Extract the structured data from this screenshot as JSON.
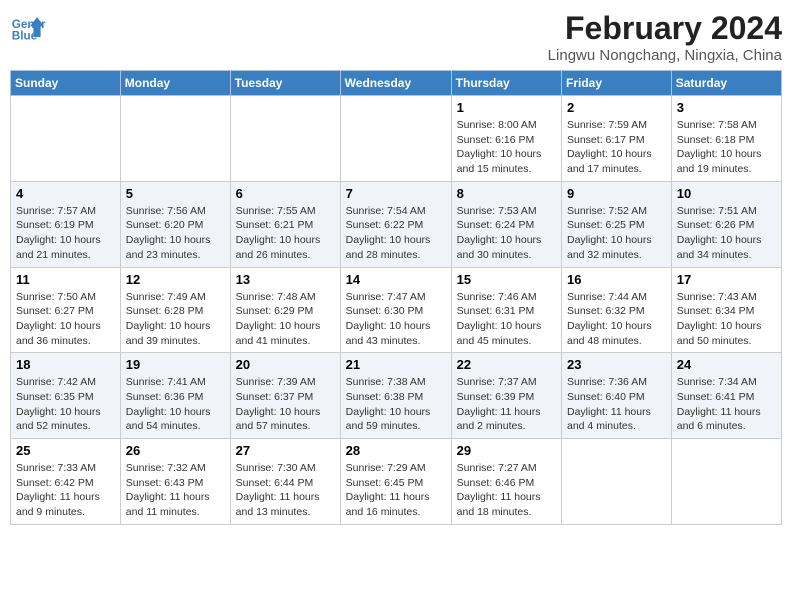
{
  "header": {
    "logo_line1": "General",
    "logo_line2": "Blue",
    "main_title": "February 2024",
    "subtitle": "Lingwu Nongchang, Ningxia, China"
  },
  "weekdays": [
    "Sunday",
    "Monday",
    "Tuesday",
    "Wednesday",
    "Thursday",
    "Friday",
    "Saturday"
  ],
  "weeks": [
    [
      {
        "day": "",
        "info": ""
      },
      {
        "day": "",
        "info": ""
      },
      {
        "day": "",
        "info": ""
      },
      {
        "day": "",
        "info": ""
      },
      {
        "day": "1",
        "info": "Sunrise: 8:00 AM\nSunset: 6:16 PM\nDaylight: 10 hours\nand 15 minutes."
      },
      {
        "day": "2",
        "info": "Sunrise: 7:59 AM\nSunset: 6:17 PM\nDaylight: 10 hours\nand 17 minutes."
      },
      {
        "day": "3",
        "info": "Sunrise: 7:58 AM\nSunset: 6:18 PM\nDaylight: 10 hours\nand 19 minutes."
      }
    ],
    [
      {
        "day": "4",
        "info": "Sunrise: 7:57 AM\nSunset: 6:19 PM\nDaylight: 10 hours\nand 21 minutes."
      },
      {
        "day": "5",
        "info": "Sunrise: 7:56 AM\nSunset: 6:20 PM\nDaylight: 10 hours\nand 23 minutes."
      },
      {
        "day": "6",
        "info": "Sunrise: 7:55 AM\nSunset: 6:21 PM\nDaylight: 10 hours\nand 26 minutes."
      },
      {
        "day": "7",
        "info": "Sunrise: 7:54 AM\nSunset: 6:22 PM\nDaylight: 10 hours\nand 28 minutes."
      },
      {
        "day": "8",
        "info": "Sunrise: 7:53 AM\nSunset: 6:24 PM\nDaylight: 10 hours\nand 30 minutes."
      },
      {
        "day": "9",
        "info": "Sunrise: 7:52 AM\nSunset: 6:25 PM\nDaylight: 10 hours\nand 32 minutes."
      },
      {
        "day": "10",
        "info": "Sunrise: 7:51 AM\nSunset: 6:26 PM\nDaylight: 10 hours\nand 34 minutes."
      }
    ],
    [
      {
        "day": "11",
        "info": "Sunrise: 7:50 AM\nSunset: 6:27 PM\nDaylight: 10 hours\nand 36 minutes."
      },
      {
        "day": "12",
        "info": "Sunrise: 7:49 AM\nSunset: 6:28 PM\nDaylight: 10 hours\nand 39 minutes."
      },
      {
        "day": "13",
        "info": "Sunrise: 7:48 AM\nSunset: 6:29 PM\nDaylight: 10 hours\nand 41 minutes."
      },
      {
        "day": "14",
        "info": "Sunrise: 7:47 AM\nSunset: 6:30 PM\nDaylight: 10 hours\nand 43 minutes."
      },
      {
        "day": "15",
        "info": "Sunrise: 7:46 AM\nSunset: 6:31 PM\nDaylight: 10 hours\nand 45 minutes."
      },
      {
        "day": "16",
        "info": "Sunrise: 7:44 AM\nSunset: 6:32 PM\nDaylight: 10 hours\nand 48 minutes."
      },
      {
        "day": "17",
        "info": "Sunrise: 7:43 AM\nSunset: 6:34 PM\nDaylight: 10 hours\nand 50 minutes."
      }
    ],
    [
      {
        "day": "18",
        "info": "Sunrise: 7:42 AM\nSunset: 6:35 PM\nDaylight: 10 hours\nand 52 minutes."
      },
      {
        "day": "19",
        "info": "Sunrise: 7:41 AM\nSunset: 6:36 PM\nDaylight: 10 hours\nand 54 minutes."
      },
      {
        "day": "20",
        "info": "Sunrise: 7:39 AM\nSunset: 6:37 PM\nDaylight: 10 hours\nand 57 minutes."
      },
      {
        "day": "21",
        "info": "Sunrise: 7:38 AM\nSunset: 6:38 PM\nDaylight: 10 hours\nand 59 minutes."
      },
      {
        "day": "22",
        "info": "Sunrise: 7:37 AM\nSunset: 6:39 PM\nDaylight: 11 hours\nand 2 minutes."
      },
      {
        "day": "23",
        "info": "Sunrise: 7:36 AM\nSunset: 6:40 PM\nDaylight: 11 hours\nand 4 minutes."
      },
      {
        "day": "24",
        "info": "Sunrise: 7:34 AM\nSunset: 6:41 PM\nDaylight: 11 hours\nand 6 minutes."
      }
    ],
    [
      {
        "day": "25",
        "info": "Sunrise: 7:33 AM\nSunset: 6:42 PM\nDaylight: 11 hours\nand 9 minutes."
      },
      {
        "day": "26",
        "info": "Sunrise: 7:32 AM\nSunset: 6:43 PM\nDaylight: 11 hours\nand 11 minutes."
      },
      {
        "day": "27",
        "info": "Sunrise: 7:30 AM\nSunset: 6:44 PM\nDaylight: 11 hours\nand 13 minutes."
      },
      {
        "day": "28",
        "info": "Sunrise: 7:29 AM\nSunset: 6:45 PM\nDaylight: 11 hours\nand 16 minutes."
      },
      {
        "day": "29",
        "info": "Sunrise: 7:27 AM\nSunset: 6:46 PM\nDaylight: 11 hours\nand 18 minutes."
      },
      {
        "day": "",
        "info": ""
      },
      {
        "day": "",
        "info": ""
      }
    ]
  ]
}
